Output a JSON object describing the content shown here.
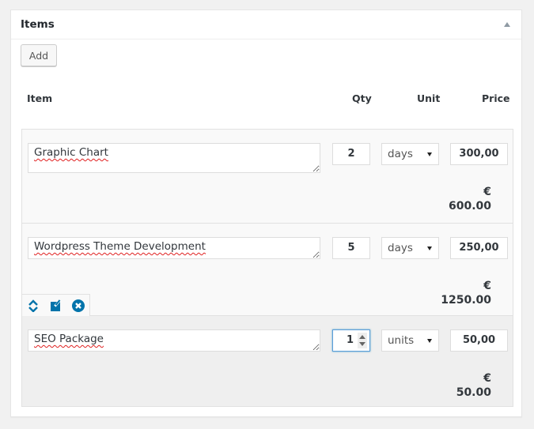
{
  "panel": {
    "title": "Items",
    "toggle_icon": "triangle-up-icon"
  },
  "toolbar": {
    "add_label": "Add"
  },
  "columns": {
    "item": "Item",
    "qty": "Qty",
    "unit": "Unit",
    "price": "Price"
  },
  "rows": [
    {
      "description": "Graphic Chart",
      "qty": "2",
      "unit": "days",
      "price": "300,00",
      "currency": "€",
      "total": "600.00"
    },
    {
      "description": "Wordpress Theme Development",
      "qty": "5",
      "unit": "days",
      "price": "250,00",
      "currency": "€",
      "total": "1250.00"
    },
    {
      "description": "SEO Package",
      "qty": "1",
      "unit": "units",
      "price": "50,00",
      "currency": "€",
      "total": "50.00"
    }
  ],
  "row_actions": {
    "icons": [
      "sort-icon",
      "edit-icon",
      "remove-icon"
    ],
    "color": "#0073aa"
  },
  "colors": {
    "accent": "#0073aa",
    "focus_border": "#5b9dd9",
    "spellcheck": "#e02020"
  }
}
